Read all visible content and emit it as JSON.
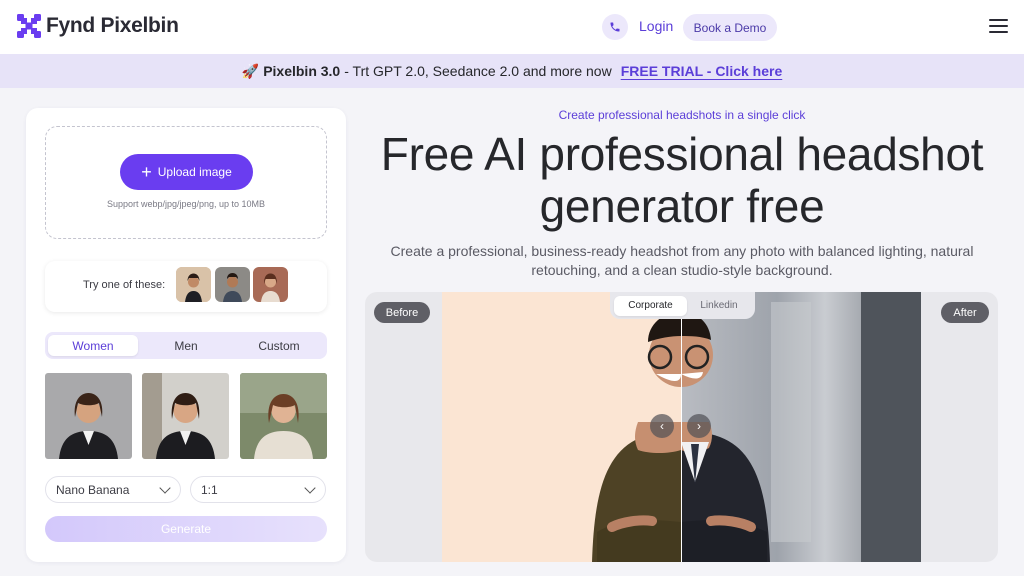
{
  "header": {
    "logo_text": "Fynd Pixelbin",
    "login": "Login",
    "book_demo": "Book a Demo",
    "brand_color": "#6a3df0"
  },
  "banner": {
    "emoji": "🚀",
    "product": "Pixelbin 3.0",
    "text": "- Trt GPT 2.0, Seedance 2.0 and more now",
    "cta": "FREE TRIAL - Click here"
  },
  "upload": {
    "button_label": "Upload image",
    "support_text": "Support webp/jpg/jpeg/png, up to 10MB"
  },
  "try": {
    "label": "Try one of these:"
  },
  "tabs": {
    "items": [
      "Women",
      "Men",
      "Custom"
    ],
    "active": "Women"
  },
  "controls": {
    "model": "Nano Banana",
    "ratio": "1:1",
    "generate": "Generate"
  },
  "hero": {
    "eyebrow": "Create professional headshots in a single click",
    "title": "Free AI professional headshot generator free",
    "subtitle": "Create a professional, business-ready headshot from any photo with balanced lighting, natural retouching, and a clean studio-style background."
  },
  "compare": {
    "before": "Before",
    "after": "After",
    "styles": [
      "Corporate",
      "Linkedin"
    ],
    "active_style": "Corporate"
  }
}
